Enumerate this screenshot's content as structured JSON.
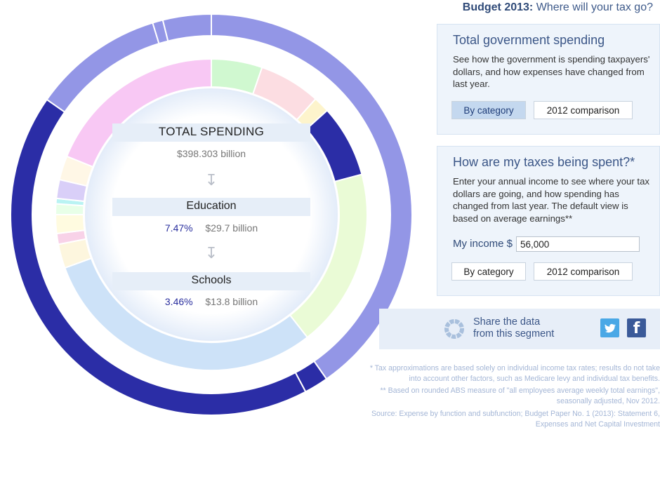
{
  "header": {
    "title_bold": "Budget 2013:",
    "title_rest": "Where will your tax go?"
  },
  "center": {
    "total_label": "TOTAL SPENDING",
    "total_amount": "$398.303 billion",
    "level1_name": "Education",
    "level1_pct": "7.47%",
    "level1_amount": "$29.7 billion",
    "level2_name": "Schools",
    "level2_pct": "3.46%",
    "level2_amount": "$13.8 billion"
  },
  "panel1": {
    "heading": "Total government spending",
    "description": "See how the government is spending taxpayers' dollars, and how expenses have changed from last year.",
    "btn_category": "By category",
    "btn_comparison": "2012 comparison",
    "active": "By category"
  },
  "panel2": {
    "heading": "How are my taxes being spent?*",
    "description": "Enter your annual income to see where your tax dollars are going, and how spending has changed from last year. The default view is based on average earnings**",
    "income_label": "My income $",
    "income_value": "56,000",
    "btn_category": "By category",
    "btn_comparison": "2012 comparison"
  },
  "share": {
    "line1": "Share the data",
    "line2": "from this segment",
    "twitter_icon": "twitter-icon",
    "facebook_icon": "facebook-icon"
  },
  "footnotes": {
    "note1": "* Tax approximations are based solely on individual income tax rates; results do not take into account other factors, such as Medicare levy and individual tax benefits.",
    "note2": "** Based on rounded ABS measure of \"all employees average weekly total earnings\", seasonally adjusted, Nov 2012.",
    "source": "Source: Expense by function and subfunction; Budget Paper No. 1 (2013): Statement 6, Expenses and Net Capital Investment"
  },
  "colors": {
    "selected_dark": "#2b2da6",
    "outer_light": "#9396e6",
    "accent_title": "#2f4a78",
    "panel_bg": "#eef4fb"
  },
  "chart_data": {
    "type": "pie",
    "title": "TOTAL SPENDING",
    "total": "$398.303 billion",
    "rings": [
      {
        "name": "outer",
        "segments": [
          {
            "start_deg": 0,
            "end_deg": 145,
            "color": "#9396e6"
          },
          {
            "start_deg": 145,
            "end_deg": 152,
            "color": "#2b2da6",
            "selected": true,
            "label": "Education"
          },
          {
            "start_deg": 152,
            "end_deg": 305,
            "color": "#2b2da6"
          },
          {
            "start_deg": 305,
            "end_deg": 343,
            "color": "#9396e6"
          },
          {
            "start_deg": 343,
            "end_deg": 346,
            "color": "#9396e6"
          },
          {
            "start_deg": 346,
            "end_deg": 360,
            "color": "#9396e6"
          }
        ]
      },
      {
        "name": "inner",
        "segments": [
          {
            "start_deg": 0,
            "end_deg": 19,
            "color": "#d0f8d0"
          },
          {
            "start_deg": 19,
            "end_deg": 42,
            "color": "#fcdde2"
          },
          {
            "start_deg": 42,
            "end_deg": 48,
            "color": "#fdf4cc"
          },
          {
            "start_deg": 48,
            "end_deg": 75,
            "color": "#2b2da6",
            "selected": true,
            "label": "Schools"
          },
          {
            "start_deg": 75,
            "end_deg": 142,
            "color": "#eafbd6"
          },
          {
            "start_deg": 142,
            "end_deg": 250,
            "color": "#cde2f8"
          },
          {
            "start_deg": 250,
            "end_deg": 259,
            "color": "#fdf6de"
          },
          {
            "start_deg": 259,
            "end_deg": 263,
            "color": "#f8d2e8"
          },
          {
            "start_deg": 263,
            "end_deg": 270,
            "color": "#fffbe0"
          },
          {
            "start_deg": 270,
            "end_deg": 274,
            "color": "#e8ffe8"
          },
          {
            "start_deg": 274,
            "end_deg": 276,
            "color": "#b9f3f3"
          },
          {
            "start_deg": 276,
            "end_deg": 283,
            "color": "#d9cff8"
          },
          {
            "start_deg": 283,
            "end_deg": 292,
            "color": "#fff7e6"
          },
          {
            "start_deg": 292,
            "end_deg": 360,
            "color": "#f8c8f4"
          }
        ]
      }
    ]
  }
}
